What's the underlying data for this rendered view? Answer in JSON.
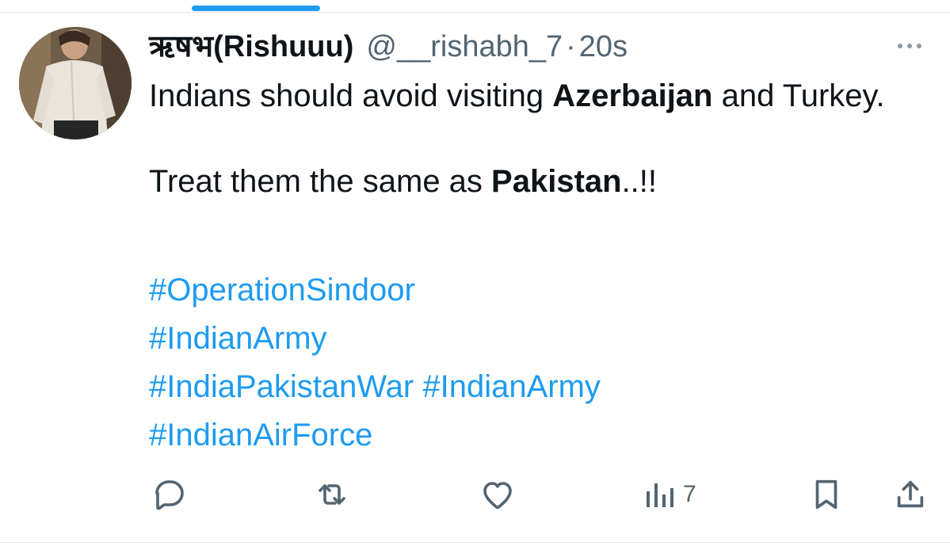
{
  "tweet": {
    "author": {
      "display_name": "ऋषभ(Rishuuu)",
      "handle": "@__rishabh_7",
      "separator": "·",
      "time": "20s"
    },
    "text": {
      "line1_prefix": "Indians should avoid visiting ",
      "line1_bold": "Azerbaijan",
      "line1_suffix": " and Turkey.",
      "line2_prefix": "Treat them the same as ",
      "line2_bold": "Pakistan",
      "line2_suffix": "..!!"
    },
    "hashtags": [
      "#OperationSindoor",
      "#IndianArmy",
      "#IndiaPakistanWar",
      "#IndianArmy",
      "#IndianAirForce"
    ],
    "stats": {
      "views": "7"
    }
  },
  "icons": {
    "more": "more-horizontal-icon",
    "reply": "reply-icon",
    "retweet": "retweet-icon",
    "like": "heart-icon",
    "views": "views-chart-icon",
    "bookmark": "bookmark-icon",
    "share": "share-icon"
  },
  "colors": {
    "link": "#1d9bf0",
    "text": "#0f1419",
    "secondary": "#536471",
    "tab_indicator": "#1d9bf0"
  }
}
